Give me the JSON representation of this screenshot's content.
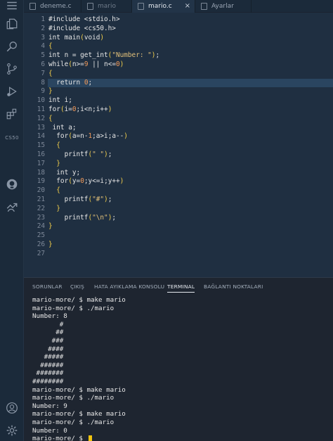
{
  "tabs": [
    {
      "label": "deneme.c",
      "active": false
    },
    {
      "label": "mario",
      "active": false
    },
    {
      "label": "mario.c",
      "active": true
    },
    {
      "label": "Ayarlar",
      "active": false
    }
  ],
  "tab_close_glyph": "×",
  "activity_bar": {
    "items": [
      "menu-icon",
      "explorer-icon",
      "search-icon",
      "source-control-icon",
      "run-debug-icon",
      "extensions-icon",
      "cs50-icon",
      "github-icon",
      "remote-icon",
      "account-icon",
      "settings-icon"
    ],
    "cs50_label": "CS50"
  },
  "editor": {
    "highlighted_line": 8,
    "lines": [
      {
        "n": "1",
        "text": "#include <stdio.h>"
      },
      {
        "n": "2",
        "text": "#include <cs50.h>"
      },
      {
        "n": "3",
        "text": "int main(void)"
      },
      {
        "n": "4",
        "text": "{"
      },
      {
        "n": "5",
        "text": "int n = get_int(\"Number: \");"
      },
      {
        "n": "6",
        "text": "while(n>=9 || n<=0)"
      },
      {
        "n": "7",
        "text": "{"
      },
      {
        "n": "8",
        "text": "  return 0;"
      },
      {
        "n": "9",
        "text": "}"
      },
      {
        "n": "10",
        "text": "int i;"
      },
      {
        "n": "11",
        "text": "for(i=0;i<n;i++)"
      },
      {
        "n": "12",
        "text": "{"
      },
      {
        "n": "13",
        "text": " int a;"
      },
      {
        "n": "14",
        "text": "  for(a=n-1;a>i;a--)"
      },
      {
        "n": "15",
        "text": "  {"
      },
      {
        "n": "16",
        "text": "    printf(\" \");"
      },
      {
        "n": "17",
        "text": "  }"
      },
      {
        "n": "18",
        "text": "  int y;"
      },
      {
        "n": "19",
        "text": "  for(y=0;y<=i;y++)"
      },
      {
        "n": "20",
        "text": "  {"
      },
      {
        "n": "21",
        "text": "    printf(\"#\");"
      },
      {
        "n": "22",
        "text": "  }"
      },
      {
        "n": "23",
        "text": "    printf(\"\\n\");"
      },
      {
        "n": "24",
        "text": "}"
      },
      {
        "n": "25",
        "text": ""
      },
      {
        "n": "26",
        "text": "}"
      },
      {
        "n": "27",
        "text": ""
      }
    ]
  },
  "panel": {
    "tabs": [
      "SORUNLAR",
      "ÇIKIŞ",
      "HATA AYIKLAMA KONSOLU",
      "TERMINAL",
      "BAĞLANTI NOKTALARI"
    ],
    "active_tab": "TERMINAL",
    "terminal_lines": [
      "mario-more/ $ make mario",
      "mario-more/ $ ./mario",
      "Number: 8",
      "       #",
      "      ##",
      "     ###",
      "    ####",
      "   #####",
      "  ######",
      " #######",
      "########",
      "mario-more/ $ make mario",
      "mario-more/ $ ./mario",
      "Number: 9",
      "mario-more/ $ make mario",
      "mario-more/ $ ./mario",
      "Number: 0",
      "mario-more/ $ "
    ]
  },
  "colors": {
    "editor_bg": "#1f2f41",
    "panel_bg": "#1e2530",
    "highlight_line": "#2a4560",
    "cursor": "#f1c40f"
  }
}
